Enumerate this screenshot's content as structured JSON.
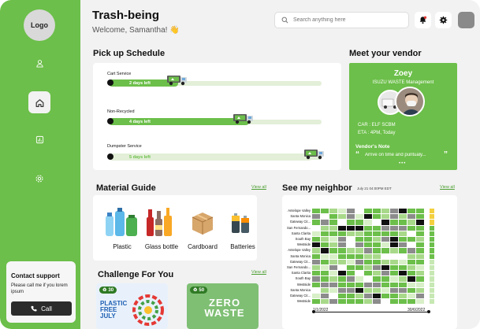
{
  "sidebar": {
    "logo": "Logo",
    "nav": [
      "user-icon",
      "home-icon",
      "chart-icon",
      "settings-icon"
    ],
    "contact": {
      "title": "Contact support",
      "desc": "Please call me if you lorem ipsum",
      "call_label": "Call"
    }
  },
  "header": {
    "title": "Trash-being",
    "subtitle": "Welcome, Samantha! 👋",
    "search_placeholder": "Search anything here",
    "accent": "#6cbf4a"
  },
  "pickup": {
    "title": "Pick up Schedule",
    "rows": [
      {
        "label": "Cart Service",
        "status": "2 days left",
        "progress": 0.3
      },
      {
        "label": "Non-Recycled",
        "status": "4 days left",
        "progress": 0.65
      },
      {
        "label": "Dumpster Service",
        "status": "5 days left",
        "progress": 0.95
      }
    ]
  },
  "vendor": {
    "title": "Meet your vendor",
    "name": "Zoey",
    "company": "ISUZU WASTE Management",
    "car": "CAR : ELF SCBM",
    "eta": "ETA : 4PM, Today",
    "note_title": "Vendor's Note",
    "note": "Arrive on time and puntualy..."
  },
  "material": {
    "title": "Material Guide",
    "view_all": "View all",
    "items": [
      "Plastic",
      "Glass bottle",
      "Cardboard",
      "Batteries"
    ]
  },
  "neighbor": {
    "title": "See my neighbor",
    "timestamp": "July 21 04:00PM EDT",
    "view_all": "View all",
    "rows": [
      "Antelope Valley",
      "Santa Monica",
      "Gateway Cit...",
      "San Fernando...",
      "Santa Clarita",
      "South Bay",
      "Westside",
      "Antelope Valley",
      "Santa Monica",
      "Gateway Cit...",
      "San Fernando...",
      "Santa Clarita",
      "South Bay",
      "Westside",
      "Santa Monica",
      "Gateway Cit...",
      "Westside"
    ],
    "date_start": "1/1/2022",
    "date_end": "30/6/2022"
  },
  "challenge": {
    "title": "Challenge For You",
    "view_all": "View all",
    "cards": [
      {
        "count": "30",
        "text": "PLASTIC FREE JULY"
      },
      {
        "count": "50",
        "text": "ZERO WASTE"
      }
    ]
  }
}
